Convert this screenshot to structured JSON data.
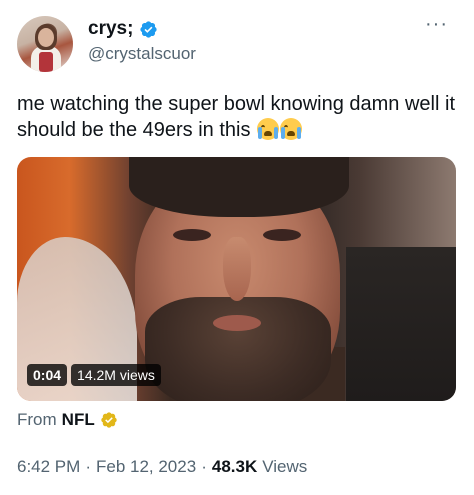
{
  "author": {
    "display_name": "crys;",
    "handle": "@crystalscuor",
    "verified": true,
    "avatar_icon": "avatar-photo"
  },
  "more_menu": {
    "label": "···",
    "icon": "more-horizontal-icon"
  },
  "tweet": {
    "text": "me watching the super bowl knowing damn well it should be the 49ers in this ",
    "emojis": [
      "loudly-crying-face",
      "loudly-crying-face"
    ]
  },
  "media": {
    "type": "video",
    "timestamp": "0:04",
    "views": "14.2M views"
  },
  "source": {
    "prefix": "From",
    "org": "NFL",
    "badge": "gold-verified-icon"
  },
  "meta": {
    "time": "6:42 PM",
    "separator": "·",
    "date": "Feb 12, 2023",
    "views_count": "48.3K",
    "views_label": "Views"
  },
  "colors": {
    "verified_blue": "#1d9bf0",
    "gold_badge": "#e2b719",
    "secondary_text": "#536471",
    "primary_text": "#0f1419"
  }
}
